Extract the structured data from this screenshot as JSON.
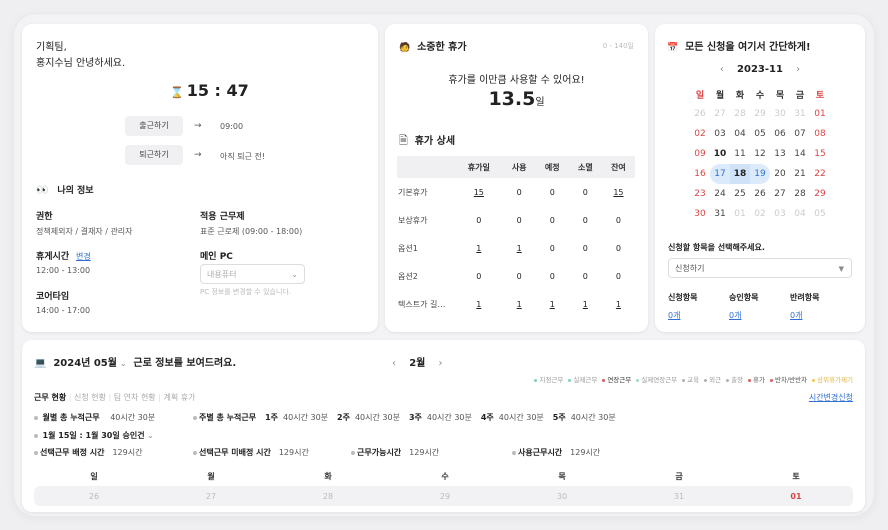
{
  "greeting": {
    "line1": "기획팀,",
    "line2": "홍지수님 안녕하세요."
  },
  "clock": {
    "time": "15 : 47"
  },
  "checkin": {
    "label": "출근하기",
    "arrow": "→",
    "time": "09:00"
  },
  "checkout": {
    "label": "퇴근하기",
    "arrow": "→",
    "status": "아직 퇴근 전!"
  },
  "myinfo": {
    "title": "나의 정보",
    "role_label": "권한",
    "role_value": "정책제외자 / 결재자 / 관리자",
    "rule_label": "적용 근무제",
    "rule_value": "표준 근로제 (09:00 - 18:00)",
    "break_label": "휴게시간",
    "break_change": "변경",
    "break_value": "12:00 - 13:00",
    "pc_label": "메인 PC",
    "pc_select": "내용퓨터",
    "pc_hint": "PC 정보를 변경할 수 있습니다.",
    "core_label": "코어타임",
    "core_value": "14:00 - 17:00"
  },
  "vacation": {
    "title": "소중한 휴가",
    "range": "0 - 140일",
    "msg": "휴가를 이만큼 사용할 수 있어요!",
    "amount": "13.5",
    "unit": "일",
    "detail_title": "휴가 상세",
    "headers": [
      "",
      "휴가일",
      "사용",
      "예정",
      "소멸",
      "잔여"
    ],
    "rows": [
      {
        "name": "기본휴가",
        "cells": [
          "15",
          "0",
          "0",
          "0",
          "15"
        ],
        "u": [
          true,
          false,
          false,
          false,
          true
        ]
      },
      {
        "name": "보상휴가",
        "cells": [
          "0",
          "0",
          "0",
          "0",
          "0"
        ],
        "u": [
          false,
          false,
          false,
          false,
          false
        ]
      },
      {
        "name": "옵션1",
        "cells": [
          "1",
          "1",
          "0",
          "0",
          "0"
        ],
        "u": [
          true,
          true,
          false,
          false,
          false
        ]
      },
      {
        "name": "옵션2",
        "cells": [
          "0",
          "0",
          "0",
          "0",
          "0"
        ],
        "u": [
          false,
          false,
          false,
          false,
          false
        ]
      },
      {
        "name": "텍스트가 길…",
        "cells": [
          "1",
          "1",
          "1",
          "1",
          "1"
        ],
        "u": [
          true,
          true,
          true,
          true,
          true
        ]
      }
    ]
  },
  "apply": {
    "title": "모든 신청을 여기서 간단하게!",
    "month": "2023-11",
    "weekdays": [
      "일",
      "월",
      "화",
      "수",
      "목",
      "금",
      "토"
    ],
    "weeks": [
      [
        "26",
        "27",
        "28",
        "29",
        "30",
        "31",
        "01"
      ],
      [
        "02",
        "03",
        "04",
        "05",
        "06",
        "07",
        "08"
      ],
      [
        "09",
        "10",
        "11",
        "12",
        "13",
        "14",
        "15"
      ],
      [
        "16",
        "17",
        "18",
        "19",
        "20",
        "21",
        "22"
      ],
      [
        "23",
        "24",
        "25",
        "26",
        "27",
        "28",
        "29"
      ],
      [
        "30",
        "31",
        "01",
        "02",
        "03",
        "04",
        "05"
      ]
    ],
    "select_prompt": "신청할 항목을 선택해주세요.",
    "select_value": "신청하기",
    "stats": [
      {
        "label": "신청항목",
        "value": "0개"
      },
      {
        "label": "승인항목",
        "value": "0개"
      },
      {
        "label": "반려항목",
        "value": "0개"
      }
    ]
  },
  "work": {
    "year_month": "2024년 05월",
    "caption": "근로 정보를 보여드려요.",
    "month_nav": "2월",
    "legend": [
      {
        "label": "지정근무",
        "color": "#7fcfbf"
      },
      {
        "label": "실제근무",
        "color": "#7fcfbf"
      },
      {
        "label": "연장근무",
        "color": "#e05a5a"
      },
      {
        "label": "실제연장근무",
        "color": "#a0d8cc"
      },
      {
        "label": "교육",
        "color": "#b0b0b0"
      },
      {
        "label": "외근",
        "color": "#b0b0b0"
      },
      {
        "label": "출장",
        "color": "#b0b0b0"
      },
      {
        "label": "휴가",
        "color": "#e05a5a"
      },
      {
        "label": "반차/반반차",
        "color": "#e05a5a"
      },
      {
        "label": "상위휴가제기",
        "color": "#f2c94c"
      }
    ],
    "tabs": [
      "근무 현황",
      "신청 현황",
      "팀 연차 현황",
      "계획 휴가"
    ],
    "change_link": "시간변경신청",
    "monthly_label": "월별 총 누적근무",
    "monthly_value": "40시간 30분",
    "weekly_label": "주별 총 누적근무",
    "weeks": [
      {
        "w": "1주",
        "v": "40시간 30분"
      },
      {
        "w": "2주",
        "v": "40시간 30분"
      },
      {
        "w": "3주",
        "v": "40시간 30분"
      },
      {
        "w": "4주",
        "v": "40시간 30분"
      },
      {
        "w": "5주",
        "v": "40시간 30분"
      }
    ],
    "approval": "1월 15일 : 1월 30일 승인건",
    "stats": [
      {
        "label": "선택근무 배정 시간",
        "value": "129시간"
      },
      {
        "label": "선택근무 미배정 시간",
        "value": "129시간"
      },
      {
        "label": "근무가능시간",
        "value": "129시간"
      },
      {
        "label": "사용근무시간",
        "value": "129시간"
      }
    ],
    "weekdays": [
      "일",
      "월",
      "화",
      "수",
      "목",
      "금",
      "토"
    ],
    "dates": [
      "26",
      "27",
      "28",
      "29",
      "30",
      "31",
      "01"
    ]
  }
}
